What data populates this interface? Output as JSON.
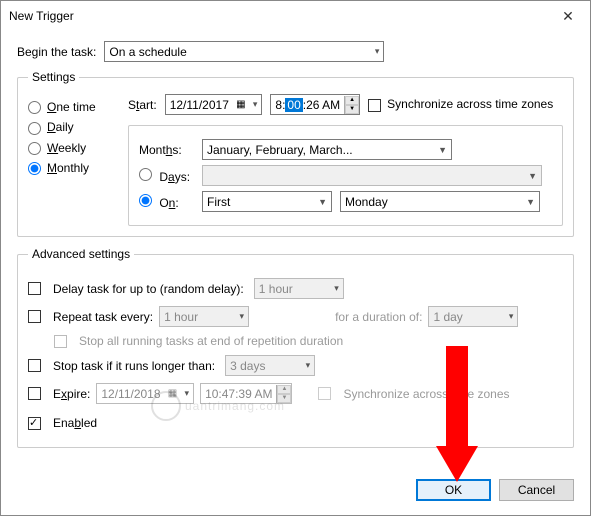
{
  "title": "New Trigger",
  "begin_label": "Begin the task:",
  "begin_value": "On a schedule",
  "settings": {
    "legend": "Settings",
    "radios": {
      "one": "One time",
      "daily": "Daily",
      "weekly": "Weekly",
      "monthly": "Monthly"
    },
    "start_label": "Start:",
    "start_date": "12/11/2017",
    "start_time_pre": "8:",
    "start_time_sel": "00",
    "start_time_post": ":26 AM",
    "sync_label": "Synchronize across time zones",
    "months_label": "Months:",
    "months_value": "January, February, March...",
    "days_label": "Days:",
    "on_label": "On:",
    "on_ord": "First",
    "on_day": "Monday"
  },
  "adv": {
    "legend": "Advanced settings",
    "delay_label": "Delay task for up to (random delay):",
    "delay_value": "1 hour",
    "repeat_label": "Repeat task every:",
    "repeat_value": "1 hour",
    "duration_label": "for a duration of:",
    "duration_value": "1 day",
    "stopall_label": "Stop all running tasks at end of repetition duration",
    "stoplong_label": "Stop task if it runs longer than:",
    "stoplong_value": "3 days",
    "expire_label": "Expire:",
    "expire_date": "12/11/2018",
    "expire_time": "10:47:39 AM",
    "expire_sync": "Synchronize across time zones",
    "enabled_label": "Enabled"
  },
  "buttons": {
    "ok": "OK",
    "cancel": "Cancel"
  },
  "watermark": "uantrimang.com"
}
